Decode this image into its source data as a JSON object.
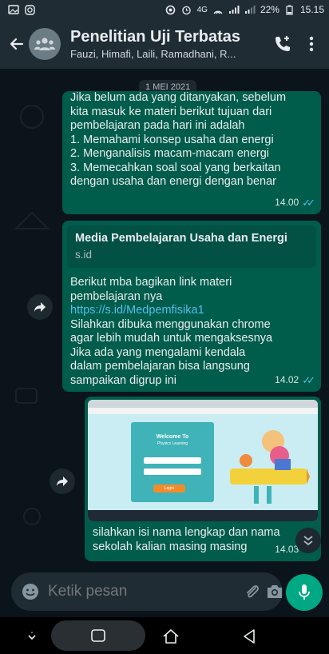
{
  "status_bar": {
    "battery": "22%",
    "time": "15.15",
    "network": "4G"
  },
  "header": {
    "title": "Penelitian Uji Terbatas",
    "subtitle": "Fauzi, Himafi, Laili, Ramadhani, R..."
  },
  "chat": {
    "date_chip": "1 MEI 2021",
    "messages": [
      {
        "text": "Jika belum ada yang ditanyakan, sebelum\nkita masuk ke materi berikut tujuan dari\npembelajaran pada hari ini adalah\n1. Memahami konsep usaha dan energi\n2. Menganalisis macam-macam energi\n3. Memecahkan soal soal yang berkaitan\ndengan usaha dan energi dengan benar",
        "time": "14.00"
      },
      {
        "preview_title": "Media Pembelajaran Usaha dan Energi",
        "preview_domain": "s.id",
        "line1": "Berikut mba bagikan link materi",
        "line2": "pembelajaran nya",
        "link": "https://s.id/Medpemfisika1",
        "line3": "Silahkan dibuka menggunakan chrome",
        "line4": "agar lebih mudah untuk mengaksesnya",
        "line5": "Jika ada yang mengalami kendala",
        "line6": "dalam pembelajaran bisa langsung",
        "line7": "sampaikan digrup ini",
        "time": "14.02"
      },
      {
        "image_welcome": "Welcome To",
        "image_sub": "Physics Learning",
        "image_login": "Login",
        "caption_line1": "silahkan isi nama lengkap dan nama",
        "caption_line2": "sekolah kalian masing masing",
        "time": "14.03"
      }
    ]
  },
  "composer": {
    "placeholder": "Ketik pesan"
  },
  "colors": {
    "header_bg": "#1f2c34",
    "chat_bg": "#0b141a",
    "outgoing_bubble": "#005c4b",
    "accent": "#00a884",
    "read_ticks": "#53bdeb"
  }
}
